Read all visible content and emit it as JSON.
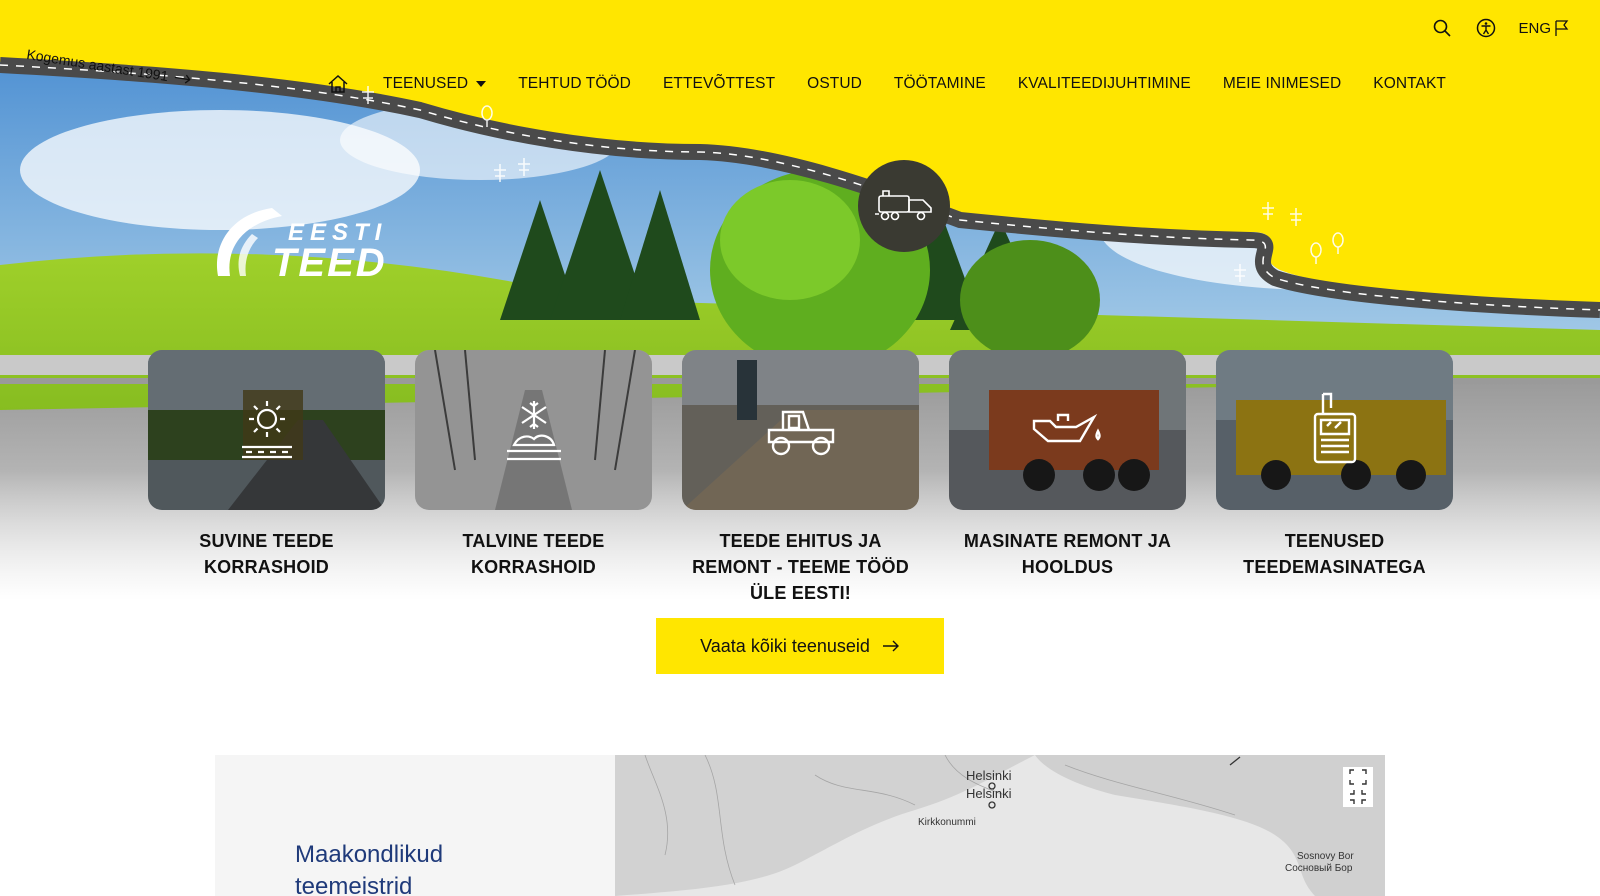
{
  "header": {
    "tagline": "Kogemus aastast 1991",
    "lang_label": "ENG",
    "nav": [
      {
        "label": "TEENUSED",
        "has_dropdown": true
      },
      {
        "label": "TEHTUD TÖÖD"
      },
      {
        "label": "ETTEVÕTTEST"
      },
      {
        "label": "OSTUD"
      },
      {
        "label": "TÖÖTAMINE"
      },
      {
        "label": "KVALITEEDIJUHTIMINE"
      },
      {
        "label": "MEIE INIMESED"
      },
      {
        "label": "KONTAKT"
      }
    ]
  },
  "logo": {
    "line1": "EESTI",
    "line2": "TEED"
  },
  "services": [
    {
      "title": "SUVINE TEEDE KORRASHOID",
      "icon": "sun-road-icon"
    },
    {
      "title": "TALVINE TEEDE KORRASHOID",
      "icon": "snow-road-icon"
    },
    {
      "title": "TEEDE EHITUS JA REMONT - TEEME TÖÖD ÜLE EESTI!",
      "icon": "tractor-icon"
    },
    {
      "title": "MASINATE REMONT JA HOOLDUS",
      "icon": "oil-can-icon"
    },
    {
      "title": "TEENUSED TEEDEMASINATEGA",
      "icon": "truck-front-icon"
    }
  ],
  "cta": {
    "label": "Vaata kõiki teenuseid"
  },
  "map_section": {
    "title": "Maakondlikud teemeistrid",
    "labels": {
      "helsinki_1": "Helsinki",
      "helsinki_2": "Helsinki",
      "kirkkonummi": "Kirkkonummi",
      "sosnovy_latin": "Sosnovy Bor",
      "sosnovy_cyr": "Сосновый Бор"
    }
  },
  "colors": {
    "accent": "#ffe600",
    "dark": "#3a3a32",
    "title_blue": "#1f3a7a"
  }
}
